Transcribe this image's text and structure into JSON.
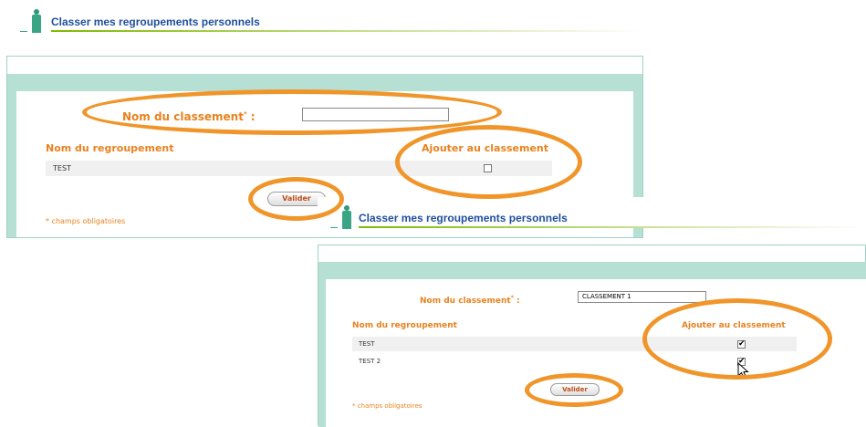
{
  "screens": [
    {
      "title": "Classer mes regroupements personnels",
      "name_label": "Nom du classement",
      "name_value": "",
      "col_group": "Nom du regroupement",
      "col_add": "Ajouter au classement",
      "rows": [
        {
          "label": "TEST",
          "checked": false
        }
      ],
      "submit": "Valider",
      "required_note": "* champs obligatoires"
    },
    {
      "title": "Classer mes regroupements personnels",
      "name_label": "Nom du classement",
      "name_value": "CLASSEMENT 1",
      "col_group": "Nom du regroupement",
      "col_add": "Ajouter au classement",
      "rows": [
        {
          "label": "TEST",
          "checked": true
        },
        {
          "label": "TEST 2",
          "checked": true
        }
      ],
      "submit": "Valider",
      "required_note": "* champs obligatoires"
    }
  ],
  "colors": {
    "accent_orange": "#f0952a",
    "label_orange": "#e8821e",
    "band_teal": "#b7e0d4",
    "title_blue": "#1f4f9f"
  },
  "icons": [
    "person-icon",
    "checkbox-icon",
    "mouse-pointer-icon"
  ]
}
